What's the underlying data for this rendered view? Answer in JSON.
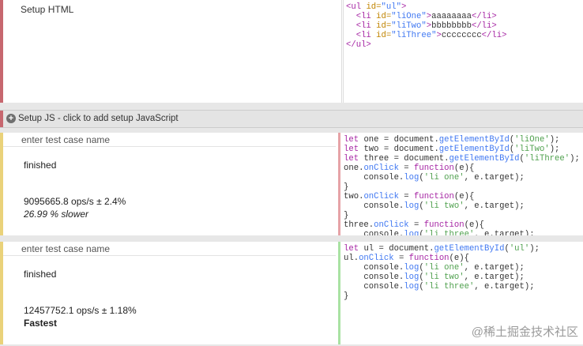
{
  "setup_html": {
    "title": "Setup HTML",
    "code_lines": [
      [
        {
          "t": "<ul ",
          "c": "tag"
        },
        {
          "t": "id=",
          "c": "attr"
        },
        {
          "t": "\"ul\"",
          "c": "fn"
        },
        {
          "t": ">",
          "c": "tag"
        }
      ],
      [
        {
          "t": "  <li ",
          "c": "tag"
        },
        {
          "t": "id=",
          "c": "attr"
        },
        {
          "t": "\"liOne\"",
          "c": "fn"
        },
        {
          "t": ">",
          "c": "tag"
        },
        {
          "t": "aaaaaaaa",
          "c": "plain"
        },
        {
          "t": "</li>",
          "c": "tag"
        }
      ],
      [
        {
          "t": "  <li ",
          "c": "tag"
        },
        {
          "t": "id=",
          "c": "attr"
        },
        {
          "t": "\"liTwo\"",
          "c": "fn"
        },
        {
          "t": ">",
          "c": "tag"
        },
        {
          "t": "bbbbbbbb",
          "c": "plain"
        },
        {
          "t": "</li>",
          "c": "tag"
        }
      ],
      [
        {
          "t": "  <li ",
          "c": "tag"
        },
        {
          "t": "id=",
          "c": "attr"
        },
        {
          "t": "\"liThree\"",
          "c": "fn"
        },
        {
          "t": ">",
          "c": "tag"
        },
        {
          "t": "cccccccc",
          "c": "plain"
        },
        {
          "t": "</li>",
          "c": "tag"
        }
      ],
      [
        {
          "t": "</ul>",
          "c": "tag"
        }
      ]
    ]
  },
  "setup_js": {
    "label": "Setup JS - click to add setup JavaScript"
  },
  "tests": [
    {
      "placeholder": "enter test case name",
      "status": "finished",
      "ops": "9095665.8 ops/s ± 2.4%",
      "verdict": "26.99 % slower",
      "code_lines": [
        [
          {
            "t": "let ",
            "c": "kw"
          },
          {
            "t": "one = document.",
            "c": "plain"
          },
          {
            "t": "getElementById",
            "c": "fn"
          },
          {
            "t": "(",
            "c": "plain"
          },
          {
            "t": "'liOne'",
            "c": "str"
          },
          {
            "t": ");",
            "c": "plain"
          }
        ],
        [
          {
            "t": "let ",
            "c": "kw"
          },
          {
            "t": "two = document.",
            "c": "plain"
          },
          {
            "t": "getElementById",
            "c": "fn"
          },
          {
            "t": "(",
            "c": "plain"
          },
          {
            "t": "'liTwo'",
            "c": "str"
          },
          {
            "t": ");",
            "c": "plain"
          }
        ],
        [
          {
            "t": "let ",
            "c": "kw"
          },
          {
            "t": "three = document.",
            "c": "plain"
          },
          {
            "t": "getElementById",
            "c": "fn"
          },
          {
            "t": "(",
            "c": "plain"
          },
          {
            "t": "'liThree'",
            "c": "str"
          },
          {
            "t": ");",
            "c": "plain"
          }
        ],
        [
          {
            "t": "one.",
            "c": "plain"
          },
          {
            "t": "onClick",
            "c": "fn"
          },
          {
            "t": " = ",
            "c": "plain"
          },
          {
            "t": "function",
            "c": "kw"
          },
          {
            "t": "(e){",
            "c": "plain"
          }
        ],
        [
          {
            "t": "    console.",
            "c": "plain"
          },
          {
            "t": "log",
            "c": "fn"
          },
          {
            "t": "(",
            "c": "plain"
          },
          {
            "t": "'li one'",
            "c": "str"
          },
          {
            "t": ", e.target);",
            "c": "plain"
          }
        ],
        [
          {
            "t": "}",
            "c": "plain"
          }
        ],
        [
          {
            "t": "two.",
            "c": "plain"
          },
          {
            "t": "onClick",
            "c": "fn"
          },
          {
            "t": " = ",
            "c": "plain"
          },
          {
            "t": "function",
            "c": "kw"
          },
          {
            "t": "(e){",
            "c": "plain"
          }
        ],
        [
          {
            "t": "    console.",
            "c": "plain"
          },
          {
            "t": "log",
            "c": "fn"
          },
          {
            "t": "(",
            "c": "plain"
          },
          {
            "t": "'li two'",
            "c": "str"
          },
          {
            "t": ", e.target);",
            "c": "plain"
          }
        ],
        [
          {
            "t": "}",
            "c": "plain"
          }
        ],
        [
          {
            "t": "three.",
            "c": "plain"
          },
          {
            "t": "onClick",
            "c": "fn"
          },
          {
            "t": " = ",
            "c": "plain"
          },
          {
            "t": "function",
            "c": "kw"
          },
          {
            "t": "(e){",
            "c": "plain"
          }
        ],
        [
          {
            "t": "    console.",
            "c": "plain"
          },
          {
            "t": "log",
            "c": "fn"
          },
          {
            "t": "(",
            "c": "plain"
          },
          {
            "t": "'li three'",
            "c": "str"
          },
          {
            "t": ", e.target);",
            "c": "plain"
          }
        ]
      ]
    },
    {
      "placeholder": "enter test case name",
      "status": "finished",
      "ops": "12457752.1 ops/s ± 1.18%",
      "verdict": "Fastest",
      "code_lines": [
        [
          {
            "t": "let ",
            "c": "kw"
          },
          {
            "t": "ul = document.",
            "c": "plain"
          },
          {
            "t": "getElementById",
            "c": "fn"
          },
          {
            "t": "(",
            "c": "plain"
          },
          {
            "t": "'ul'",
            "c": "str"
          },
          {
            "t": ");",
            "c": "plain"
          }
        ],
        [
          {
            "t": "ul.",
            "c": "plain"
          },
          {
            "t": "onClick",
            "c": "fn"
          },
          {
            "t": " = ",
            "c": "plain"
          },
          {
            "t": "function",
            "c": "kw"
          },
          {
            "t": "(e){",
            "c": "plain"
          }
        ],
        [
          {
            "t": "    console.",
            "c": "plain"
          },
          {
            "t": "log",
            "c": "fn"
          },
          {
            "t": "(",
            "c": "plain"
          },
          {
            "t": "'li one'",
            "c": "str"
          },
          {
            "t": ", e.target);",
            "c": "plain"
          }
        ],
        [
          {
            "t": "    console.",
            "c": "plain"
          },
          {
            "t": "log",
            "c": "fn"
          },
          {
            "t": "(",
            "c": "plain"
          },
          {
            "t": "'li two'",
            "c": "str"
          },
          {
            "t": ", e.target);",
            "c": "plain"
          }
        ],
        [
          {
            "t": "    console.",
            "c": "plain"
          },
          {
            "t": "log",
            "c": "fn"
          },
          {
            "t": "(",
            "c": "plain"
          },
          {
            "t": "'li three'",
            "c": "str"
          },
          {
            "t": ", e.target);",
            "c": "plain"
          }
        ],
        [
          {
            "t": "}",
            "c": "plain"
          }
        ]
      ]
    }
  ],
  "watermark": "@稀土掘金技术社区"
}
